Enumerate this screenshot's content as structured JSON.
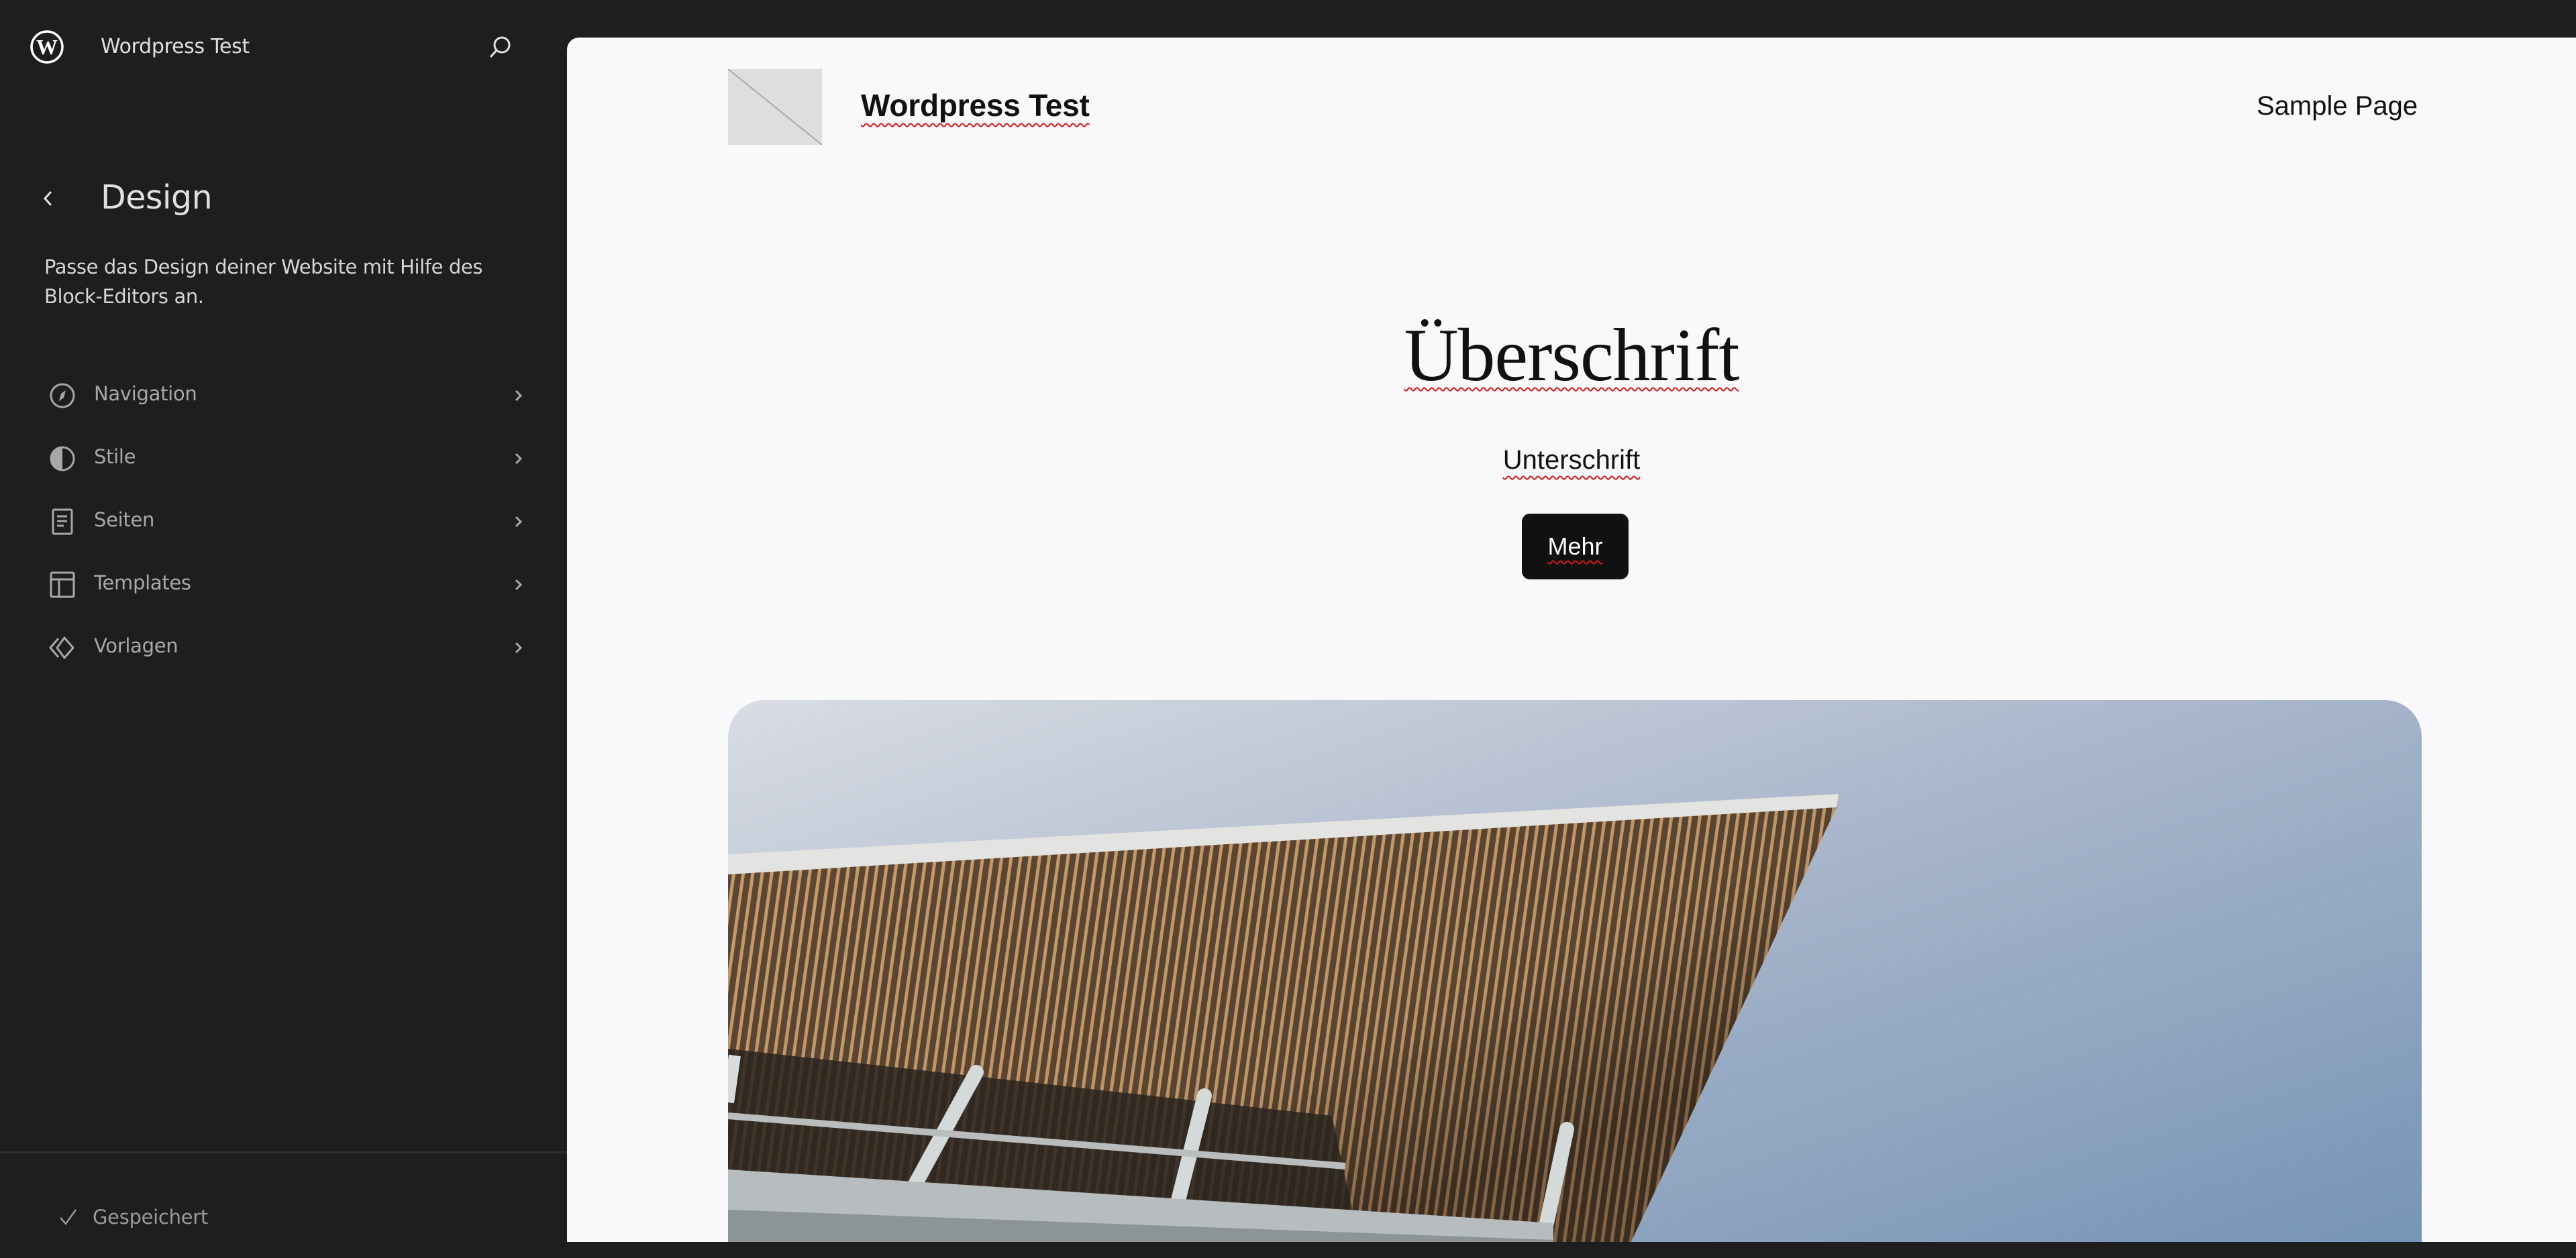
{
  "sidebar": {
    "site_name": "Wordpress Test",
    "logo_icon": "wordpress-logo-icon",
    "search_icon": "search-icon",
    "back_icon": "chevron-left-icon",
    "title": "Design",
    "description": "Passe das Design deiner Website mit Hilfe des Block-Editors an.",
    "items": [
      {
        "label": "Navigation",
        "icon": "compass-icon"
      },
      {
        "label": "Stile",
        "icon": "half-circle-contrast-icon"
      },
      {
        "label": "Seiten",
        "icon": "page-icon"
      },
      {
        "label": "Templates",
        "icon": "layout-icon"
      },
      {
        "label": "Vorlagen",
        "icon": "symbol-diamond-icon"
      }
    ],
    "status": {
      "label": "Gespeichert",
      "icon": "check-icon"
    }
  },
  "canvas": {
    "header": {
      "site_title": "Wordpress Test",
      "nav_link": "Sample Page"
    },
    "hero": {
      "heading": "Überschrift",
      "subheading": "Unterschrift",
      "button_label": "Mehr"
    },
    "cover_image": {
      "description": "Low-angle photo of a building roof overhang with wooden slats against a blue sky"
    }
  },
  "colors": {
    "sidebar_bg": "#1e1e1e",
    "canvas_bg": "#f9f9fb",
    "text_dark": "#111111",
    "spellcheck": "#d41a1a"
  }
}
